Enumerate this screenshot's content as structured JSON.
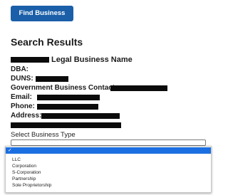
{
  "find_business_button": "Find Business",
  "search_results": {
    "title": "Search Results",
    "legal_business_name_label": "Legal Business Name",
    "dba_label": "DBA:",
    "duns_label": "DUNS:",
    "government_contact_label": "Government Business Contact:",
    "email_label": "Email:",
    "phone_label": "Phone:",
    "address_label": "Address:"
  },
  "business_type": {
    "label": "Select Business Type",
    "selected_value": "",
    "check_glyph": "✓",
    "options": [
      "LLC",
      "Corporation",
      "S-Corporation",
      "Partnership",
      "Sole Proprietorship"
    ]
  },
  "colors": {
    "button_bg": "#1a5fa8",
    "selected_option_bg": "#1c6fe0",
    "redaction": "#0b0b0b"
  }
}
